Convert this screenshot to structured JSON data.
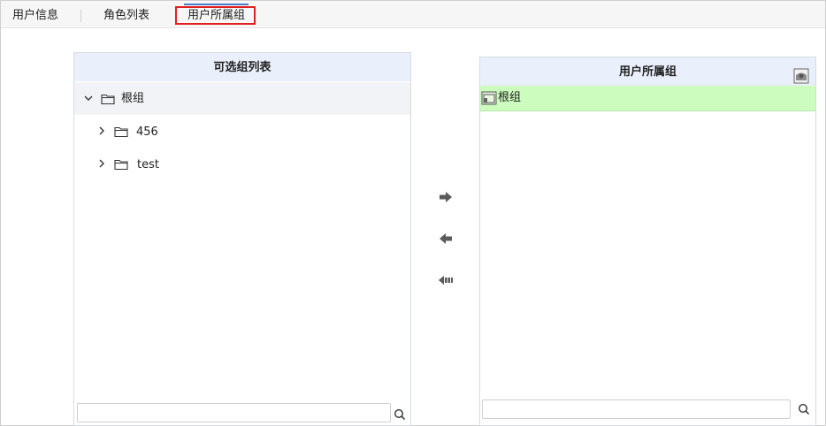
{
  "tabs": [
    {
      "label": "用户信息",
      "active": false
    },
    {
      "label": "角色列表",
      "active": false
    },
    {
      "label": "用户所属组",
      "active": true
    }
  ],
  "left_panel": {
    "title": "可选组列表",
    "tree": {
      "root": {
        "label": "根组",
        "expanded": true,
        "icon": "folder-icon"
      },
      "children": [
        {
          "label": "456",
          "expanded": false,
          "icon": "folder-icon"
        },
        {
          "label": "test",
          "expanded": false,
          "icon": "folder-icon"
        }
      ]
    },
    "search": {
      "placeholder": "",
      "value": ""
    }
  },
  "right_panel": {
    "title": "用户所属组",
    "items": [
      {
        "label": "根组",
        "selected": true,
        "icon": "group-icon"
      }
    ],
    "search": {
      "placeholder": "",
      "value": ""
    }
  },
  "actions": [
    "add-arrow",
    "remove-arrow",
    "remove-all-arrow"
  ],
  "colors": {
    "panel_header_bg": "#eaf0fb",
    "selected_row_bg": "#ccfcbe",
    "tab_highlight_border": "#e21f1f",
    "active_tab_indicator": "#4a7ec9"
  }
}
